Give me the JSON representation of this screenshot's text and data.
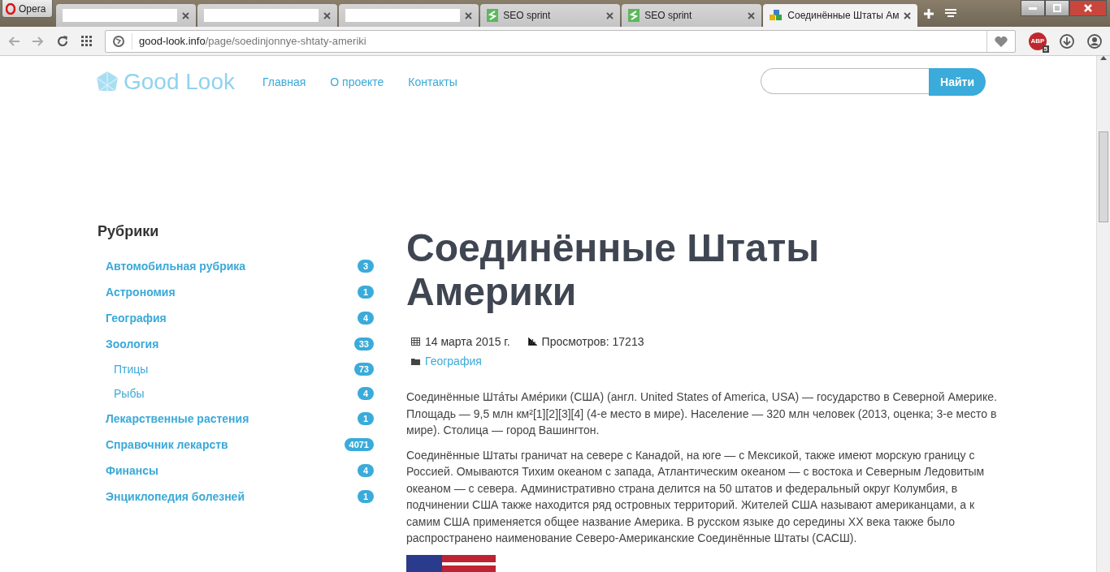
{
  "browser": {
    "menu_label": "Opera",
    "tabs": [
      {
        "kind": "redacted",
        "selected": false
      },
      {
        "kind": "redacted",
        "selected": false
      },
      {
        "kind": "redacted",
        "selected": false
      },
      {
        "kind": "seo",
        "title": "SEO sprint",
        "selected": false
      },
      {
        "kind": "seo",
        "title": "SEO sprint",
        "selected": false
      },
      {
        "kind": "site",
        "title": "Соединённые Штаты Ам",
        "selected": true
      }
    ],
    "address": {
      "domain": "good-look.info",
      "path": "/page/soedinjonnye-shtaty-ameriki"
    },
    "adblock_label": "ABP",
    "adblock_count": "5"
  },
  "site": {
    "logo": "Good Look",
    "nav": [
      "Главная",
      "О проекте",
      "Контакты"
    ],
    "search": {
      "button": "Найти"
    }
  },
  "sidebar": {
    "title": "Рубрики",
    "items": [
      {
        "label": "Автомобильная рубрика",
        "count": "3"
      },
      {
        "label": "Астрономия",
        "count": "1"
      },
      {
        "label": "География",
        "count": "4"
      },
      {
        "label": "Зоология",
        "count": "33",
        "children": [
          {
            "label": "Птицы",
            "count": "73"
          },
          {
            "label": "Рыбы",
            "count": "4"
          }
        ]
      },
      {
        "label": "Лекарственные растения",
        "count": "1"
      },
      {
        "label": "Справочник лекарств",
        "count": "4071"
      },
      {
        "label": "Финансы",
        "count": "4"
      },
      {
        "label": "Энциклопедия болезней",
        "count": "1"
      }
    ]
  },
  "article": {
    "title": "Соединённые Штаты Америки",
    "date": "14 марта 2015 г.",
    "views": "Просмотров: 17213",
    "category": "География",
    "paragraphs": [
      "Соединённые Шта́ты Аме́рики (США) (англ. United States of America, USA) — государство в Северной Америке. Площадь — 9,5 млн км²[1][2][3][4] (4-е место в мире). Население — 320 млн человек (2013, оценка; 3-е место в мире). Столица — город Вашингтон.",
      "Соединённые Штаты граничат на севере с Канадой, на юге — с Мексикой, также имеют морскую границу с Россией. Омываются Тихим океаном с запада, Атлантическим океаном — с востока и Северным Ледовитым океаном — с севера. Административно страна делится на 50 штатов и федеральный округ Колумбия, в подчинении США также находится ряд островных территорий. Жителей США называют американцами, а к самим США применяется общее название Америка. В русском языке до середины XX века также было распространено наименование Северо-Американские Соединённые Штаты (САСШ)."
    ]
  }
}
